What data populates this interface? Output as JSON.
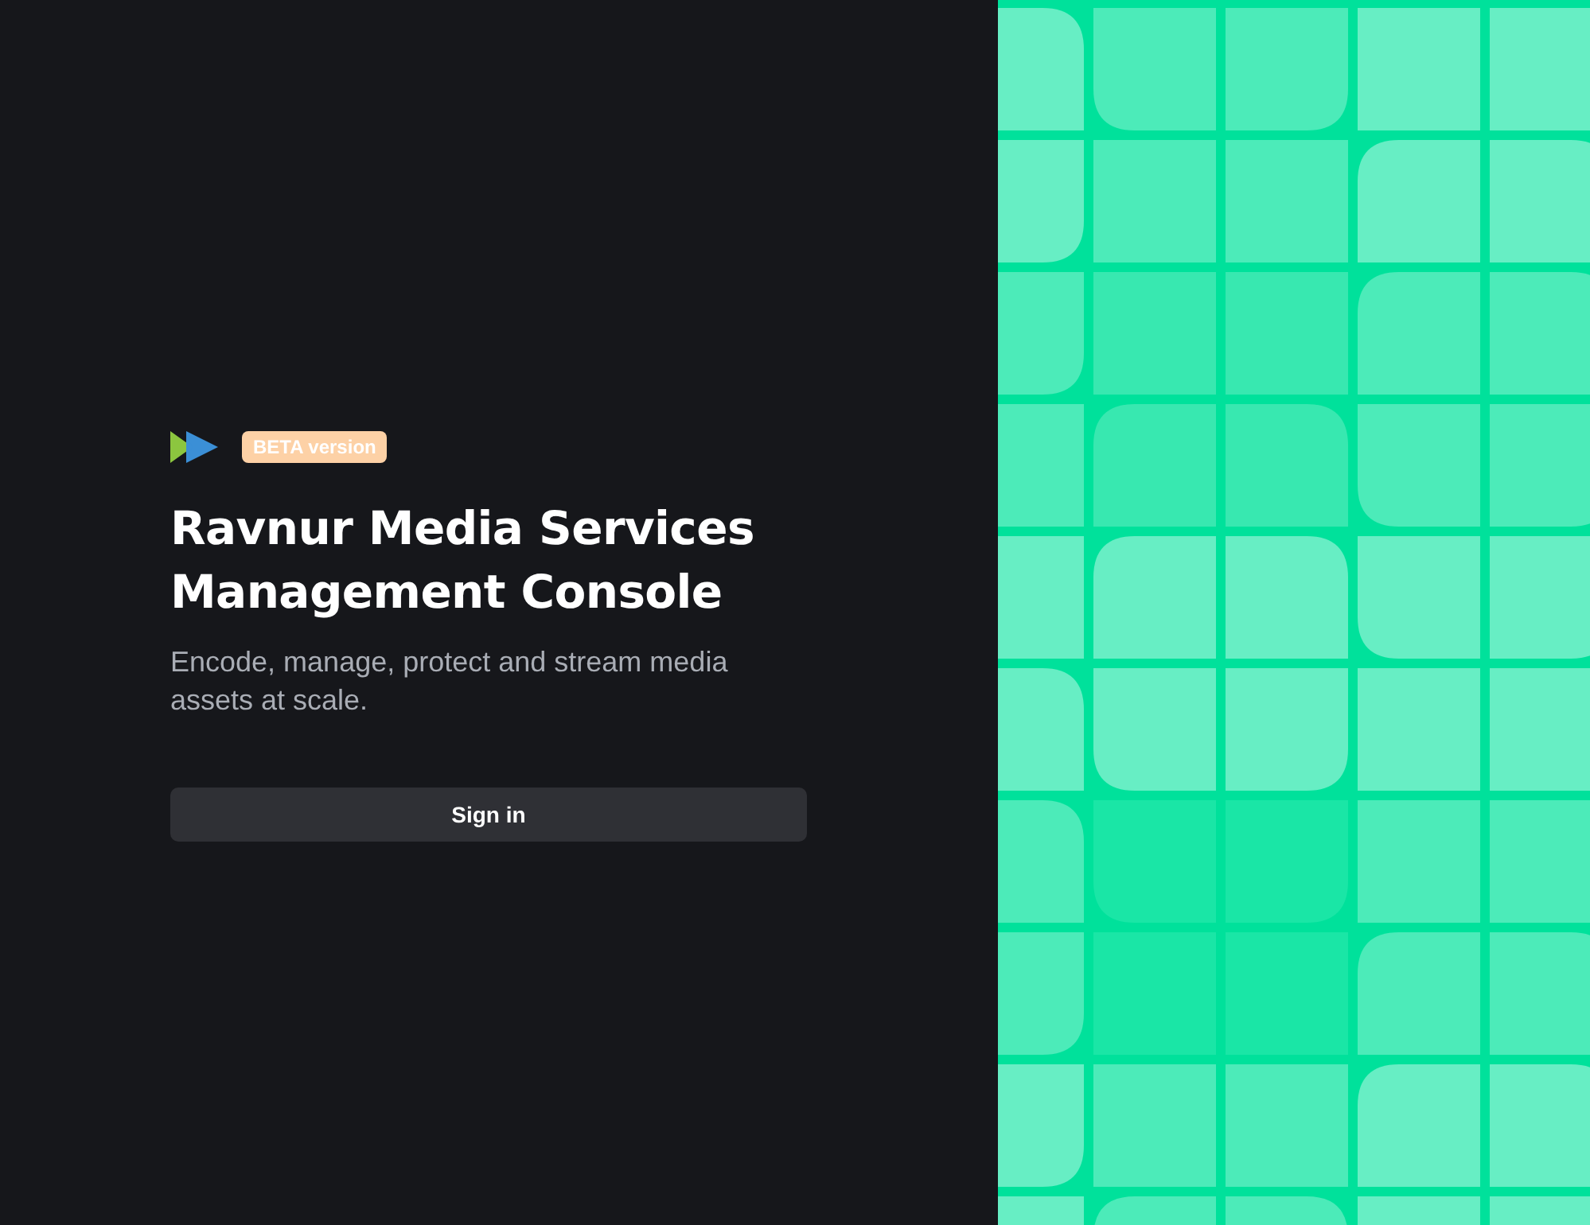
{
  "badge": "BETA version",
  "title": "Ravnur Media Services Management Console",
  "subtitle": "Encode, manage, protect and stream media assets at scale.",
  "sign_in_button": "Sign in"
}
